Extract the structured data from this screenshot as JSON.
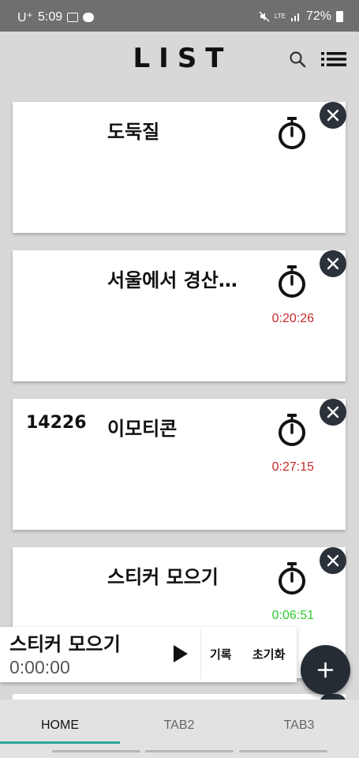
{
  "status": {
    "carrier": "U⁺",
    "time": "5:09",
    "network": "LTE",
    "battery": "72%"
  },
  "app_bar": {
    "title": "LIST"
  },
  "cards": [
    {
      "number": "",
      "title": "도둑질",
      "timer": "",
      "timer_color": "#c62828"
    },
    {
      "number": "",
      "title": "서울에서 경산…",
      "timer": "0:20:26",
      "timer_color": "#c62828"
    },
    {
      "number": "14226",
      "title": "이모티콘",
      "timer": "0:27:15",
      "timer_color": "#c62828"
    },
    {
      "number": "",
      "title": "스티커 모으기",
      "timer": "0:06:51",
      "timer_color": "#2ecc2e"
    }
  ],
  "player": {
    "title": "스티커 모으기",
    "elapsed": "0:00:00",
    "record_label": "기록",
    "reset_label": "초기화"
  },
  "tabs": [
    {
      "label": "HOME",
      "active": true
    },
    {
      "label": "TAB2",
      "active": false
    },
    {
      "label": "TAB3",
      "active": false
    }
  ],
  "colors": {
    "accent": "#2aa898",
    "dark_button": "#2b323a",
    "timer_running": "#c62828",
    "timer_active": "#2ecc2e"
  }
}
